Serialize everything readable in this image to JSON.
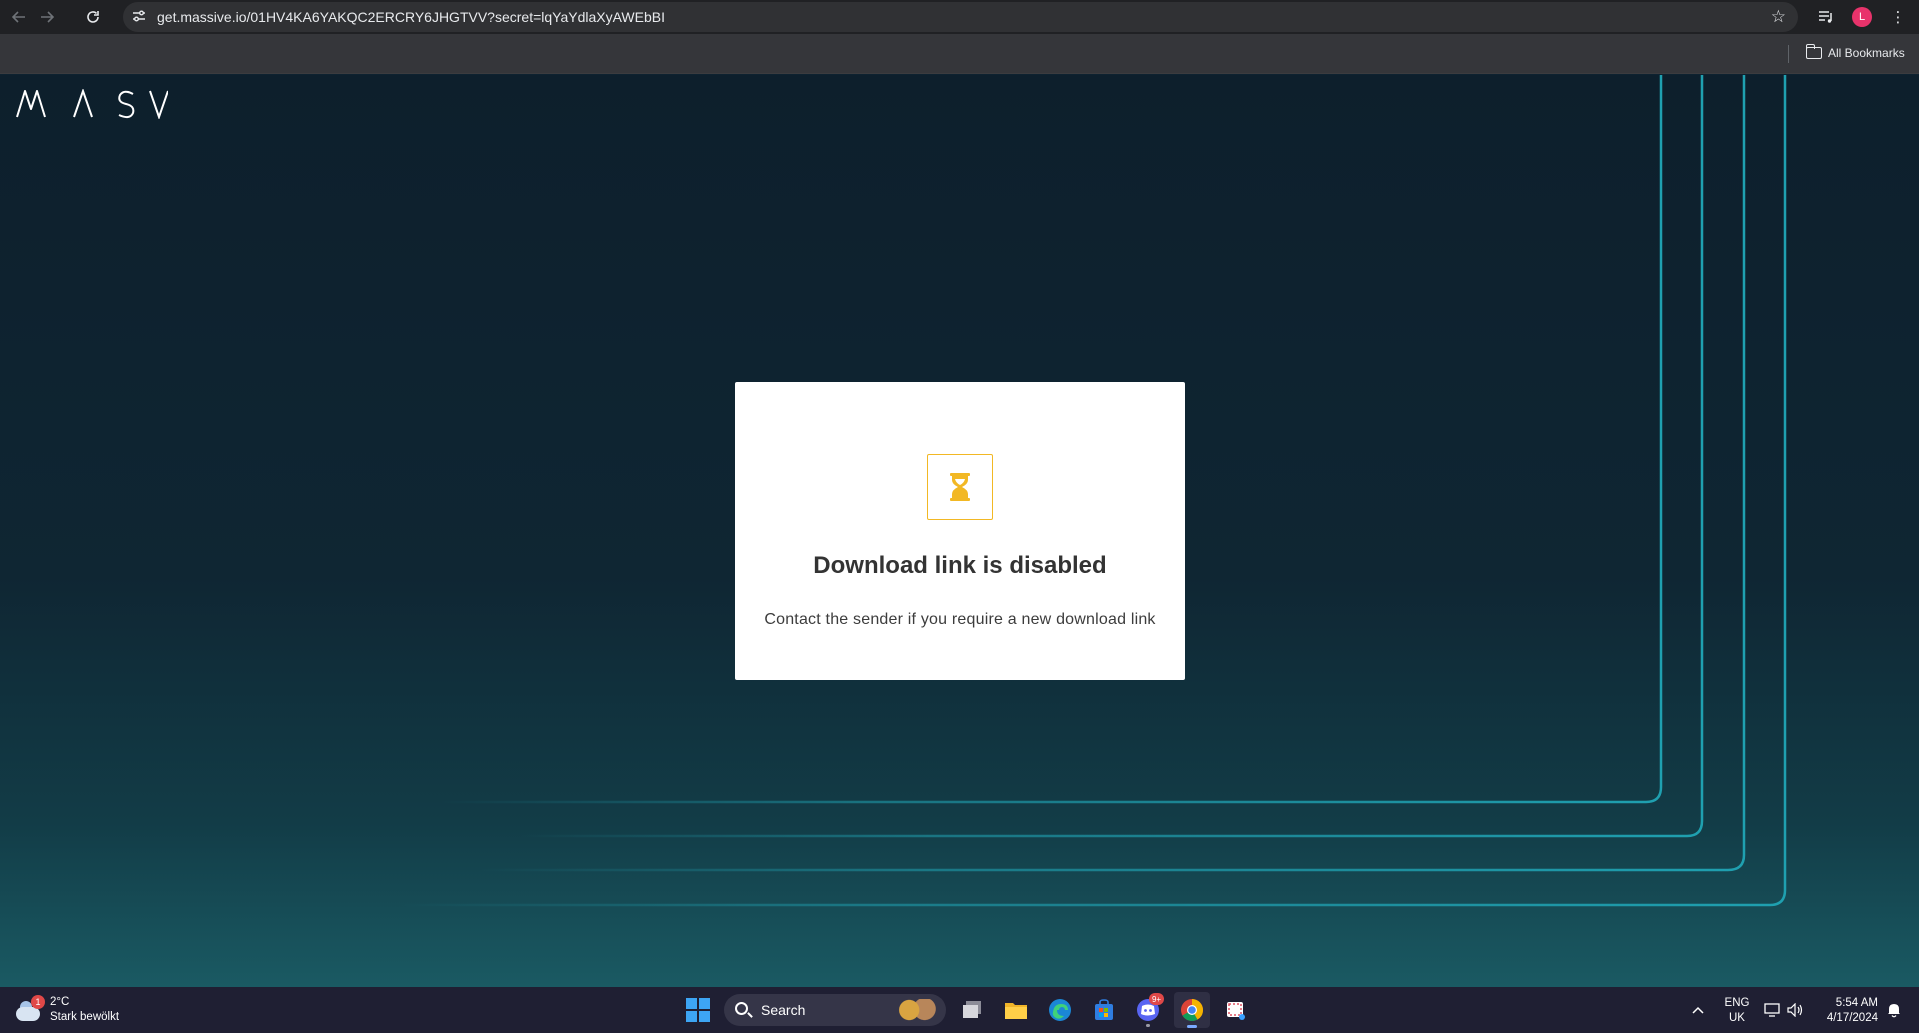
{
  "browser": {
    "url": "get.massive.io/01HV4KA6YAKQC2ERCRY6JHGTVV?secret=lqYaYdlaXyAWEbBI",
    "avatar_initial": "L",
    "bookmarks_label": "All Bookmarks"
  },
  "page": {
    "logo_text": "MASV",
    "accent_color": "#f2b824",
    "line_color": "#1fa0b0",
    "card": {
      "icon": "hourglass-icon",
      "title": "Download link is disabled",
      "message": "Contact the sender if you require a new download link"
    }
  },
  "taskbar": {
    "weather": {
      "temperature": "2°C",
      "condition": "Stark bewölkt",
      "badge": "1"
    },
    "search_label": "Search",
    "discord_badge": "9+",
    "language_line1": "ENG",
    "language_line2": "UK",
    "time": "5:54 AM",
    "date": "4/17/2024"
  }
}
